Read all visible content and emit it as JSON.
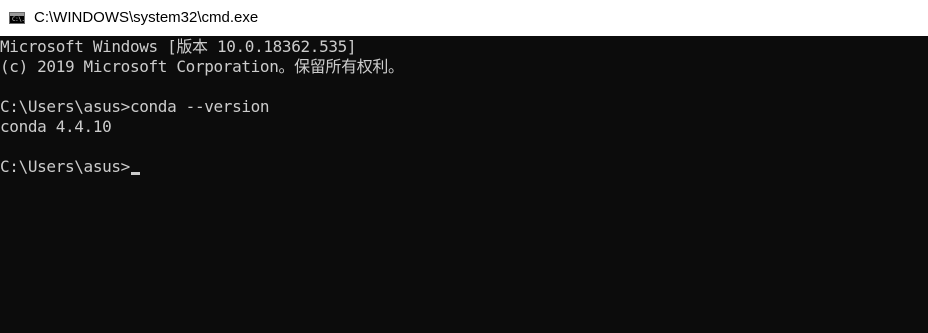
{
  "window": {
    "title": "C:\\WINDOWS\\system32\\cmd.exe",
    "icon": "cmd-console-icon",
    "icon_glyph": "C:\\."
  },
  "console": {
    "lines": [
      "Microsoft Windows [版本 10.0.18362.535]",
      "(c) 2019 Microsoft Corporation。保留所有权利。",
      "",
      "C:\\Users\\asus>conda --version",
      "conda 4.4.10",
      "",
      "C:\\Users\\asus>"
    ]
  },
  "colors": {
    "background": "#0c0c0c",
    "text": "#cccccc",
    "titlebar": "#ffffff"
  }
}
